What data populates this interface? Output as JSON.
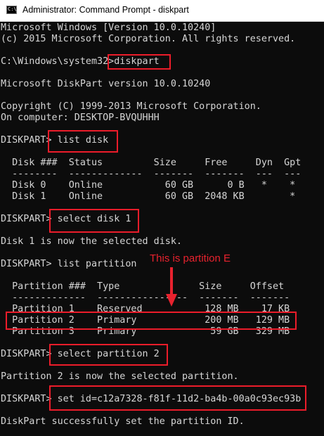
{
  "window": {
    "icon_text": "C:\\",
    "title": "Administrator: Command Prompt - diskpart"
  },
  "console": {
    "l1": "Microsoft Windows [Version 10.0.10240]",
    "l2": "(c) 2015 Microsoft Corporation. All rights reserved.",
    "l3": "C:\\Windows\\system32>diskpart",
    "l4": "Microsoft DiskPart version 10.0.10240",
    "l5": "Copyright (C) 1999-2013 Microsoft Corporation.",
    "l6": "On computer: DESKTOP-BVQUHHH",
    "l7": "DISKPART> list disk",
    "l8": "  Disk ###  Status         Size     Free     Dyn  Gpt",
    "l9": "  --------  -------------  -------  -------  ---  ---",
    "l10": "  Disk 0    Online           60 GB      0 B   *    *",
    "l11": "  Disk 1    Online           60 GB  2048 KB        *",
    "l12": "DISKPART> select disk 1",
    "l13": "Disk 1 is now the selected disk.",
    "l14": "DISKPART> list partition",
    "l15": "  Partition ###  Type              Size     Offset",
    "l16": "  -------------  ----------------  -------  -------",
    "l17": "  Partition 1    Reserved           128 MB    17 KB",
    "l18": "  Partition 2    Primary            200 MB   129 MB",
    "l19": "  Partition 3    Primary             59 GB   329 MB",
    "l20": "DISKPART> select partition 2",
    "l21": "Partition 2 is now the selected partition.",
    "l22": "DISKPART> set id=c12a7328-f81f-11d2-ba4b-00a0c93ec93b",
    "l23": "DiskPart successfully set the partition ID."
  },
  "annotation": {
    "text": "This is partition E",
    "color": "#e8222e"
  },
  "colors": {
    "console_bg": "#0c0c0c",
    "console_text": "#d6d6d6",
    "highlight": "#ec1c2a"
  }
}
